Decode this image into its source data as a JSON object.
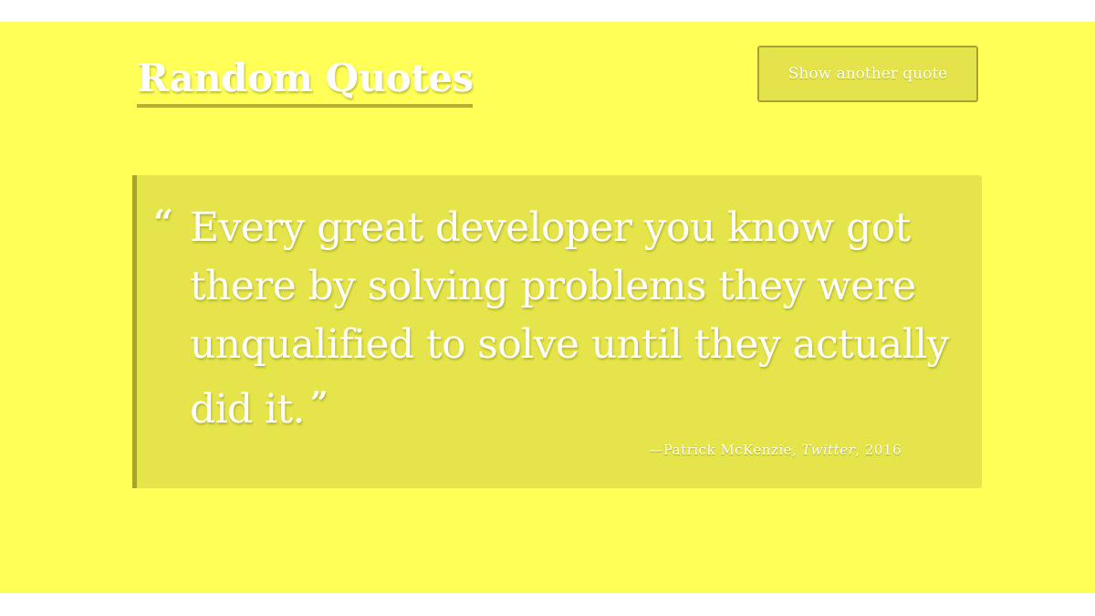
{
  "header": {
    "title": "Random Quotes",
    "button_label": "Show another quote"
  },
  "quote": {
    "open_mark": "“",
    "text": "Every great developer you know got there by solving problems they were unqualified to solve until they actually did it.",
    "close_mark": "”",
    "dash": "—",
    "author": "Patrick McKenzie",
    "separator": ", ",
    "source": "Twitter",
    "year_separator": ", ",
    "year": "2016"
  },
  "colors": {
    "background": "#ffff57",
    "panel": "#e5e44b",
    "accent": "#a6a330",
    "text": "#ffffff"
  }
}
